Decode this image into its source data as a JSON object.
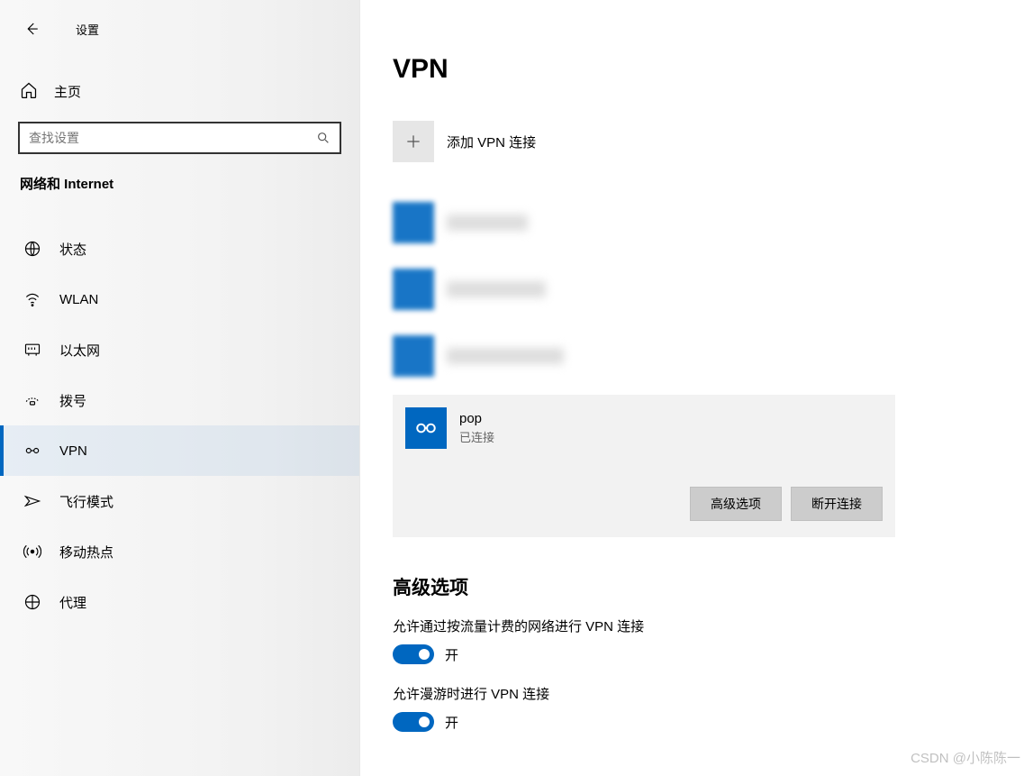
{
  "header": {
    "title": "设置"
  },
  "sidebar": {
    "home": "主页",
    "search_placeholder": "查找设置",
    "category": "网络和 Internet",
    "items": [
      {
        "label": "状态",
        "icon": "globe"
      },
      {
        "label": "WLAN",
        "icon": "wifi"
      },
      {
        "label": "以太网",
        "icon": "ethernet"
      },
      {
        "label": "拨号",
        "icon": "dialup"
      },
      {
        "label": "VPN",
        "icon": "vpn",
        "active": true
      },
      {
        "label": "飞行模式",
        "icon": "airplane"
      },
      {
        "label": "移动热点",
        "icon": "hotspot"
      },
      {
        "label": "代理",
        "icon": "proxy"
      }
    ]
  },
  "main": {
    "title": "VPN",
    "add_label": "添加 VPN 连接",
    "selected": {
      "name": "pop",
      "status": "已连接"
    },
    "buttons": {
      "advanced": "高级选项",
      "disconnect": "断开连接"
    },
    "advanced_section": {
      "title": "高级选项",
      "opt1_label": "允许通过按流量计费的网络进行 VPN 连接",
      "opt1_state": "开",
      "opt2_label": "允许漫游时进行 VPN 连接",
      "opt2_state": "开"
    }
  },
  "watermark": "CSDN @小陈陈一"
}
